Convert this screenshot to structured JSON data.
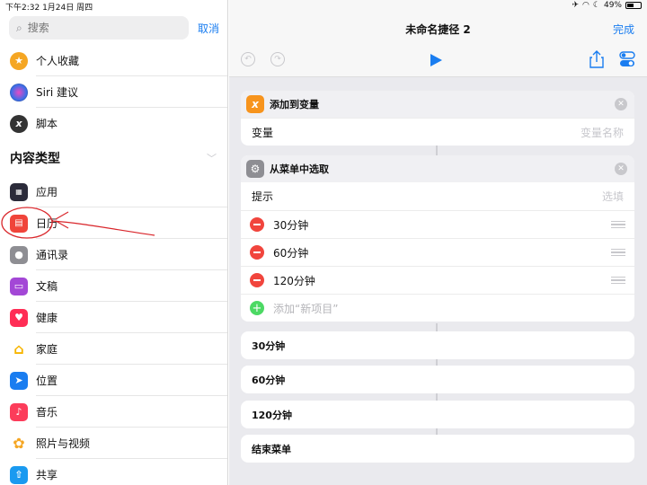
{
  "status": {
    "time": "下午2:32   1月24日 周四",
    "battery": "49%"
  },
  "sidebar": {
    "search_placeholder": "搜索",
    "cancel_label": "取消",
    "top_items": [
      {
        "label": "个人收藏",
        "icon": "star-icon",
        "color": "#f5a623"
      },
      {
        "label": "Siri 建议",
        "icon": "siri-icon",
        "color": "#3b3b5c"
      },
      {
        "label": "脚本",
        "icon": "script-icon",
        "color": "#333333"
      }
    ],
    "section_title": "内容类型",
    "content_items": [
      {
        "label": "应用",
        "icon": "apps-icon",
        "color": "#2b2b3a"
      },
      {
        "label": "日历",
        "icon": "calendar-icon",
        "color": "#f0443a"
      },
      {
        "label": "通讯录",
        "icon": "contacts-icon",
        "color": "#8e8e93"
      },
      {
        "label": "文稿",
        "icon": "documents-icon",
        "color": "#a347d6"
      },
      {
        "label": "健康",
        "icon": "health-icon",
        "color": "#ff2d55"
      },
      {
        "label": "家庭",
        "icon": "home-icon",
        "color": "#f7b500"
      },
      {
        "label": "位置",
        "icon": "location-icon",
        "color": "#1a7df0"
      },
      {
        "label": "音乐",
        "icon": "music-icon",
        "color": "#fc3c5a"
      },
      {
        "label": "照片与视频",
        "icon": "photos-icon",
        "color": "#f5a623"
      },
      {
        "label": "共享",
        "icon": "share-icon",
        "color": "#1a9af0"
      }
    ]
  },
  "editor": {
    "title": "未命名捷径 2",
    "done_label": "完成",
    "card1": {
      "title": "添加到变量",
      "badge_color": "#f7941d",
      "row_label": "变量",
      "row_placeholder": "变量名称"
    },
    "card2": {
      "title": "从菜单中选取",
      "prompt_label": "提示",
      "prompt_placeholder": "选填",
      "items": [
        "30分钟",
        "60分钟",
        "120分钟"
      ],
      "add_label": "添加“新项目”"
    },
    "menu_cases": [
      "30分钟",
      "60分钟",
      "120分钟"
    ],
    "end_menu": "结束菜单"
  }
}
